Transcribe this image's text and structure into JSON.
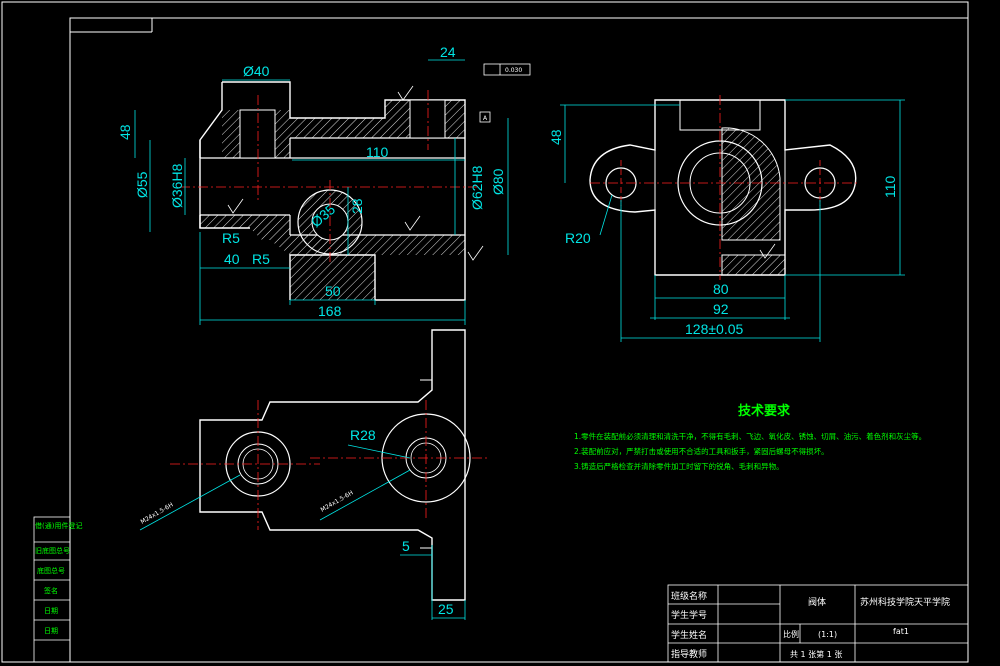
{
  "views": {
    "front": {
      "dims": {
        "d40": "Ø40",
        "d24": "24",
        "d48": "48",
        "d110": "110",
        "d55": "Ø55",
        "d36h8": "Ø36H8",
        "d62h8": "Ø62H8",
        "d80": "Ø80",
        "d35": "Ø35",
        "d28": "28",
        "r5a": "R5",
        "r5b": "R5",
        "d40b": "40",
        "d50": "50",
        "d168": "168"
      },
      "tolerance_frame": "0.030",
      "datum": "A"
    },
    "side": {
      "dims": {
        "d48": "48",
        "d110": "110",
        "r20": "R20",
        "d80": "80",
        "d92": "92",
        "d128": "128±0.05"
      }
    },
    "top": {
      "dims": {
        "r28": "R28",
        "d5": "5",
        "d25": "25",
        "thread_a": "M24x1.5-6H",
        "thread_b": "M24x1.5-6H"
      }
    }
  },
  "tech_requirements": {
    "title": "技术要求",
    "items": [
      "1.零件在装配前必须清理和清洗干净，不得有毛刺、飞边、氧化皮、锈蚀、切屑、油污、着色剂和灰尘等。",
      "2.装配前应对，严禁打击或使用不合适的工具和扳手，紧固后螺母不得损坏。",
      "3.铸造后严格检查并清除零件加工时留下的锐角、毛刺和异物。"
    ]
  },
  "title_block": {
    "labels": [
      "班级名称",
      "学生学号",
      "学生姓名",
      "指导教师"
    ],
    "part_name": "阀体",
    "scale_label": "比例",
    "scale": "(1:1)",
    "sheet": "共 1 张第 1 张",
    "school": "苏州科技学院天平学院",
    "file": "fat1"
  },
  "sidebar": {
    "items": [
      "借(通)用件登记",
      "旧底图总号",
      "底图总号",
      "签名",
      "日期",
      "日期"
    ]
  },
  "colors": {
    "outline": "#ffffff",
    "hatch": "#dddddd",
    "dimension": "#00e5e5",
    "centerline": "#ff2020",
    "text_green": "#00ff00"
  }
}
